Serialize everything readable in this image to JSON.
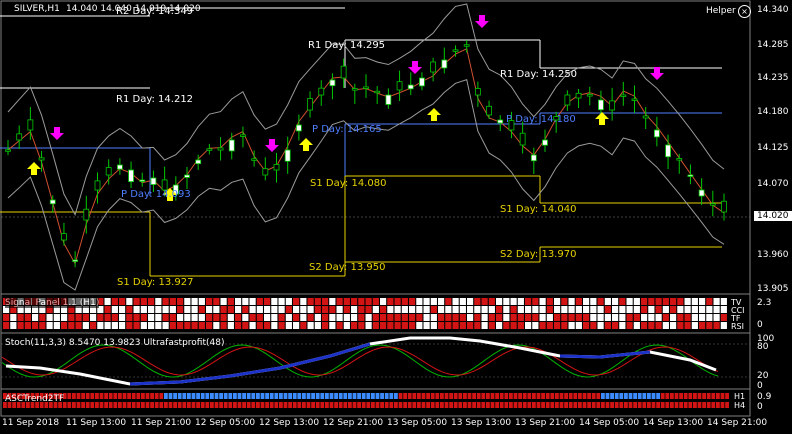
{
  "header": {
    "symbol": "SILVER,H1",
    "quote": "14.040 14.040 14.019 14.020",
    "quote_overlay": "R2 Day: 14.349",
    "helper_label": "Helper"
  },
  "pivots": {
    "r1_a": "R1 Day: 14.212",
    "p_a": "P Day: 14.093",
    "s1_a": "S1 Day: 13.927",
    "r1_b": "R1 Day: 14.295",
    "p_b": "P Day: 14.165",
    "s1_b": "S1 Day: 14.080",
    "s2_b": "S2 Day: 13.950",
    "r1_c": "R1 Day: 14.250",
    "p_c": "P Day: 14.180",
    "s1_c": "S1 Day: 14.040",
    "s2_c": "S2 Day: 13.970"
  },
  "price_axis": {
    "labels": [
      "14.340",
      "14.285",
      "14.235",
      "14.180",
      "14.125",
      "14.070",
      "14.020",
      "13.960",
      "13.905"
    ],
    "current": "14.020"
  },
  "panel1": {
    "title": "Signal Panel 1.1 (H1)",
    "rows": [
      "TV",
      "CCI",
      "TF",
      "RSI"
    ],
    "scale_top": "2.3",
    "scale_bottom": "0"
  },
  "panel2": {
    "title": "Stoch(11,3,3) 8.5470 13.9823 Ultrafastprofit(48)",
    "scale": [
      "100",
      "80",
      "20",
      "0"
    ]
  },
  "panel3": {
    "title": "ASCTrend2TF",
    "rows": [
      "H1",
      "H4"
    ],
    "scale_top": "0.9",
    "scale_bottom": "0"
  },
  "time_axis": [
    "11 Sep 2018",
    "11 Sep 13:00",
    "11 Sep 21:00",
    "12 Sep 05:00",
    "12 Sep 13:00",
    "12 Sep 21:00",
    "13 Sep 05:00",
    "13 Sep 13:00",
    "13 Sep 21:00",
    "14 Sep 05:00",
    "14 Sep 13:00",
    "14 Sep 21:00"
  ],
  "colors": {
    "background": "#000000",
    "bull_candle": "#ffffff",
    "bear_candle": "#000000",
    "wick": "#00c800",
    "buy_arrow": "#ffff00",
    "sell_arrow": "#ff00ff",
    "pivot_r": "#ffffff",
    "pivot_p": "#4f7fff",
    "pivot_s": "#e6d200",
    "panel_red": "#d21414",
    "panel_blue": "#3c8cff"
  }
}
